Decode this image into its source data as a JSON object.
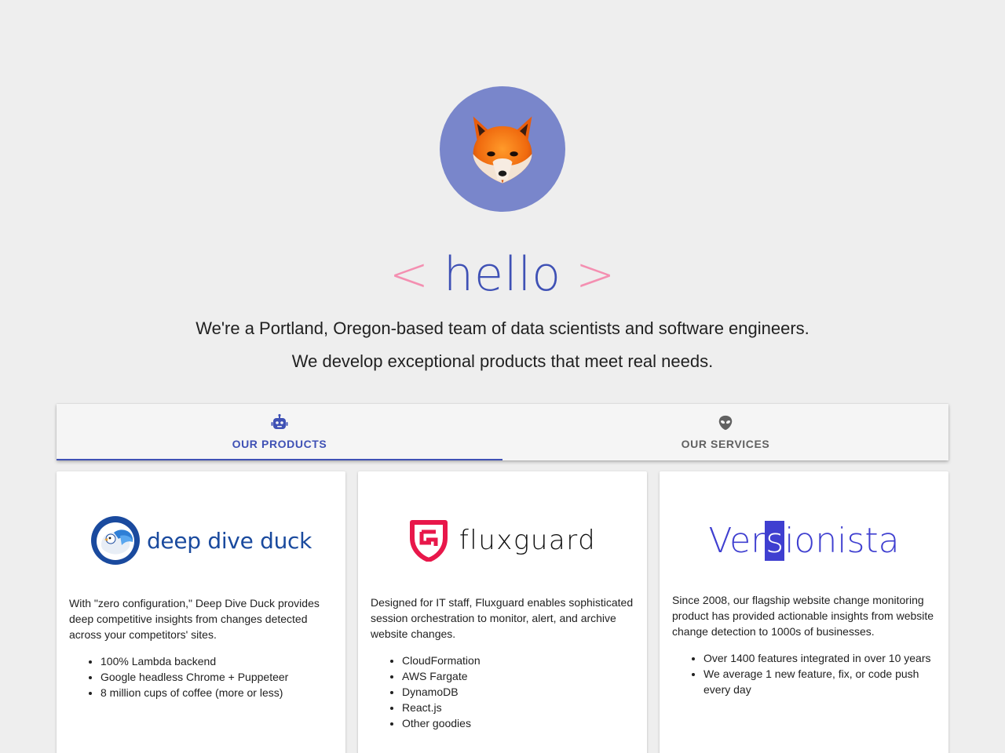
{
  "hero": {
    "avatar_icon": "fox-icon",
    "hello_open": "<",
    "hello_word": "hello",
    "hello_close": ">",
    "tagline_1": "We're a Portland, Oregon-based team of data scientists and software engineers.",
    "tagline_2": "We develop exceptional products that meet real needs."
  },
  "tabs": [
    {
      "label": "OUR PRODUCTS",
      "icon": "robot-icon",
      "active": true
    },
    {
      "label": "OUR SERVICES",
      "icon": "alien-icon",
      "active": false
    }
  ],
  "products": [
    {
      "logo_text": "deep dive duck",
      "description": "With \"zero configuration,\" Deep Dive Duck provides deep competitive insights from changes detected across your competitors' sites.",
      "bullets": [
        "100% Lambda backend",
        "Google headless Chrome + Puppeteer",
        "8 million cups of coffee (more or less)"
      ]
    },
    {
      "logo_text": "fluxguard",
      "description": "Designed for IT staff, Fluxguard enables sophisticated session orchestration to monitor, alert, and archive website changes.",
      "bullets": [
        "CloudFormation",
        "AWS Fargate",
        "DynamoDB",
        "React.js",
        "Other goodies"
      ]
    },
    {
      "logo_text_pre": "Ver",
      "logo_text_hl": "s",
      "logo_text_post": "ionista",
      "description": "Since 2008, our flagship website change monitoring product has provided actionable insights from website change detection to 1000s of businesses.",
      "bullets": [
        "Over 1400 features integrated in over 10 years",
        "We average 1 new feature, fix, or code push every day"
      ]
    }
  ],
  "colors": {
    "background": "#eeeeee",
    "avatar_bg": "#7986cb",
    "primary": "#3f51b5",
    "accent_pink": "#f48fb1",
    "fluxguard_red": "#e8174a",
    "versionista_blue": "#3f3fd0"
  }
}
